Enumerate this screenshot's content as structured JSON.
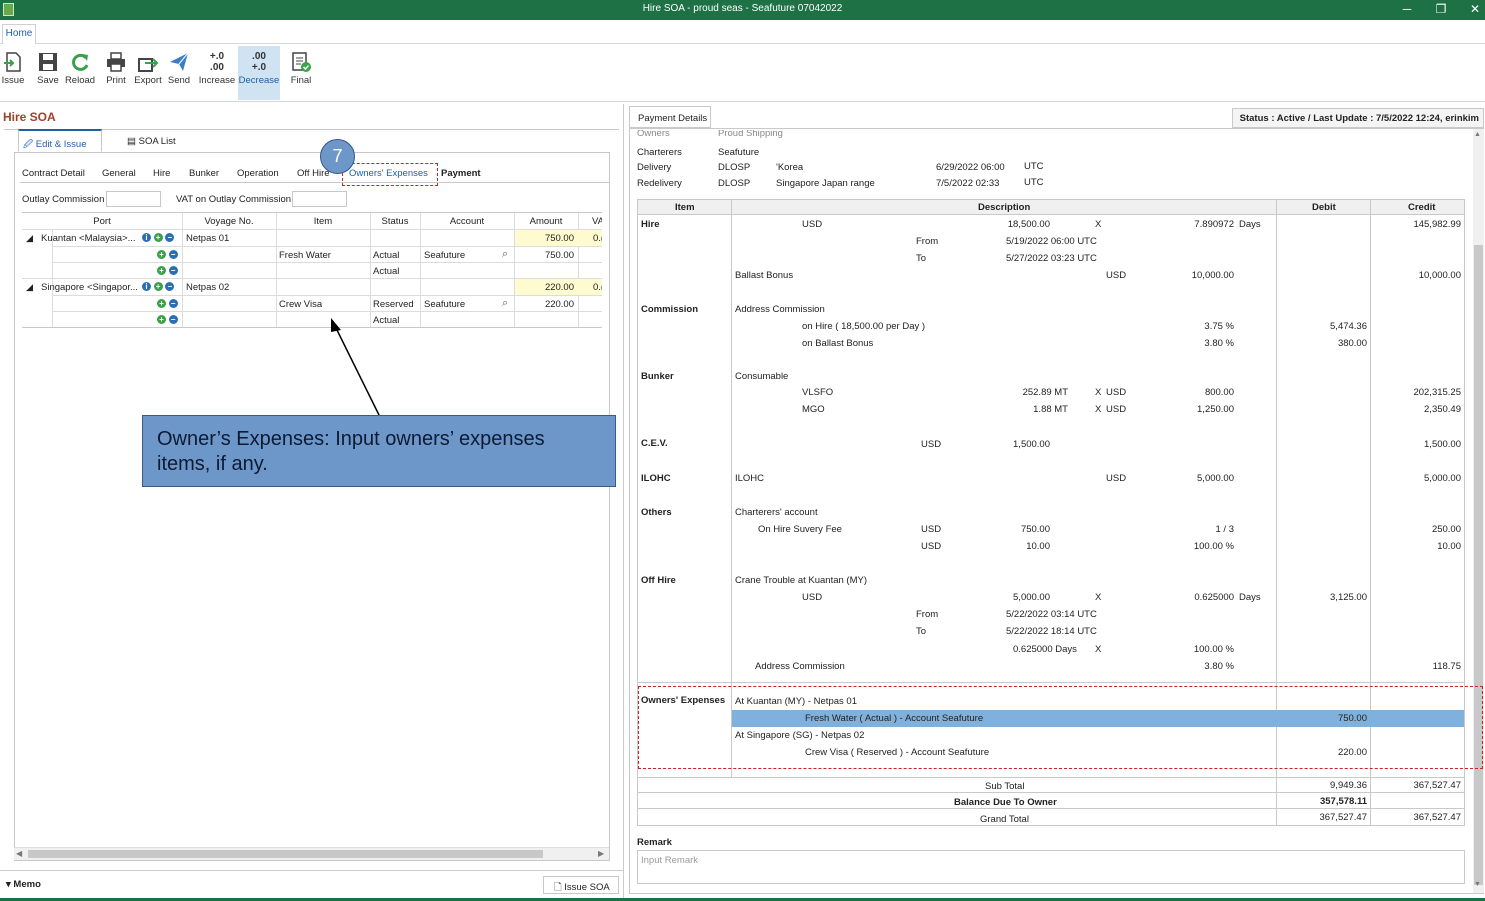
{
  "window": {
    "title": "Hire SOA - proud seas - Seafuture 07042022",
    "min": "─",
    "restore": "❐",
    "close": "✕"
  },
  "ribbon": {
    "tab_home": "Home",
    "buttons": [
      {
        "label": "Issue"
      },
      {
        "label": "Save"
      },
      {
        "label": "Reload"
      },
      {
        "label": "Print"
      },
      {
        "label": "Export"
      },
      {
        "label": "Send"
      },
      {
        "label": "Increase",
        "icon_text": "+.0\n.00"
      },
      {
        "label": "Decrease",
        "icon_text": ".00\n+.0"
      },
      {
        "label": "Final"
      }
    ]
  },
  "left": {
    "title": "Hire SOA",
    "tabs": [
      "Edit & Issue",
      "SOA List"
    ],
    "subtabs": [
      "Contract Detail",
      "General",
      "Hire",
      "Bunker",
      "Operation",
      "Off Hire",
      "Owners' Expenses",
      "Payment"
    ],
    "outlay_commission_label": "Outlay Commission",
    "vat_label": "VAT on Outlay Commission",
    "columns": [
      "Port",
      "Voyage No.",
      "Item",
      "Status",
      "Account",
      "Amount",
      "VA"
    ],
    "rows": [
      {
        "port": "Kuantan <Malaysia>...",
        "voyage": "Netpas 01",
        "amount": "750.00",
        "va": "0.("
      },
      {
        "item": "Fresh Water",
        "status": "Actual",
        "account": "Seafuture",
        "amount": "750.00"
      },
      {
        "status": "Actual"
      },
      {
        "port": "Singapore <Singapor...",
        "voyage": "Netpas 02",
        "amount": "220.00",
        "va": "0.("
      },
      {
        "item": "Crew Visa",
        "status": "Reserved",
        "account": "Seafuture",
        "amount": "220.00"
      },
      {
        "status": "Actual"
      }
    ],
    "memo": "Memo",
    "issue_button": "Issue SOA"
  },
  "step_number": "7",
  "callout": "Owner’s Expenses: Input owners’ expenses items, if any.",
  "right": {
    "payment_details": "Payment Details",
    "status": "Status : Active /  Last Update : 7/5/2022 12:24, erinkim",
    "header": {
      "owners_label": "Owners",
      "owners_val": "Proud Shipping",
      "charterers_label": "Charterers",
      "charterers_val": "Seafuture",
      "delivery_label": "Delivery",
      "delivery_port": "DLOSP",
      "delivery_place": "'Korea",
      "delivery_date": "6/29/2022 06:00",
      "delivery_tz": "UTC",
      "redelivery_label": "Redelivery",
      "redelivery_port": "DLOSP",
      "redelivery_place": "Singapore Japan range",
      "redelivery_date": "7/5/2022 02:33",
      "redelivery_tz": "UTC"
    },
    "cols": {
      "item": "Item",
      "description": "Description",
      "debit": "Debit",
      "credit": "Credit"
    },
    "hire": {
      "label": "Hire",
      "cur": "USD",
      "rate": "18,500.00",
      "x": "X",
      "days_v": "7.890972",
      "days": "Days",
      "credit": "145,982.99",
      "from_l": "From",
      "from": "5/19/2022 06:00 UTC",
      "to_l": "To",
      "to": "5/27/2022 03:23 UTC",
      "bb": "Ballast Bonus",
      "bb_cur": "USD",
      "bb_amt": "10,000.00",
      "bb_credit": "10,000.00"
    },
    "commission": {
      "label": "Commission",
      "addr": "Address Commission",
      "l1": "on Hire ( 18,500.00  per Day )",
      "p1": "3.75 %",
      "d1": "5,474.36",
      "l2": "on Ballast Bonus",
      "p2": "3.80 %",
      "d2": "380.00"
    },
    "bunker": {
      "label": "Bunker",
      "cons": "Consumable",
      "f1": "VLSFO",
      "q1": "252.89 MT",
      "x": "X",
      "c1": "USD",
      "r1": "800.00",
      "cr1": "202,315.25",
      "f2": "MGO",
      "q2": "1.88 MT",
      "c2": "USD",
      "r2": "1,250.00",
      "cr2": "2,350.49"
    },
    "cev": {
      "label": "C.E.V.",
      "cur": "USD",
      "amt": "1,500.00",
      "credit": "1,500.00"
    },
    "ilohc": {
      "label": "ILOHC",
      "desc": "ILOHC",
      "cur": "USD",
      "amt": "5,000.00",
      "credit": "5,000.00"
    },
    "others": {
      "label": "Others",
      "desc": "Charterers' account",
      "l1": "On Hire Suvery Fee",
      "c1": "USD",
      "a1": "750.00",
      "f1": "1 / 3",
      "cr1": "250.00",
      "c2": "USD",
      "a2": "10.00",
      "f2": "100.00 %",
      "cr2": "10.00"
    },
    "offhire": {
      "label": "Off Hire",
      "desc": "Crane Trouble at Kuantan (MY)",
      "cur": "USD",
      "amt": "5,000.00",
      "x": "X",
      "days_v": "0.625000",
      "days": "Days",
      "debit": "3,125.00",
      "from_l": "From",
      "from": "5/22/2022 03:14 UTC",
      "to_l": "To",
      "to": "5/22/2022 18:14 UTC",
      "dd": "0.625000 Days",
      "dx": "X",
      "dp": "100.00 %",
      "ac": "Address Commission",
      "acp": "3.80 %",
      "acc": "118.75"
    },
    "owners_expenses": {
      "label": "Owners' Expenses",
      "at1": "At   Kuantan (MY) - Netpas 01",
      "i1": "Fresh Water ( Actual ) - Account Seafuture",
      "d1": "750.00",
      "at2": "At   Singapore (SG) - Netpas 02",
      "i2": "Crew Visa ( Reserved ) - Account Seafuture",
      "d2": "220.00"
    },
    "totals": {
      "sub": "Sub Total",
      "sub_d": "9,949.36",
      "sub_c": "367,527.47",
      "bal": "Balance Due To Owner",
      "bal_d": "357,578.11",
      "grand": "Grand Total",
      "grand_d": "367,527.47",
      "grand_c": "367,527.47"
    },
    "remark": "Remark",
    "remark_ph": "Input Remark"
  }
}
